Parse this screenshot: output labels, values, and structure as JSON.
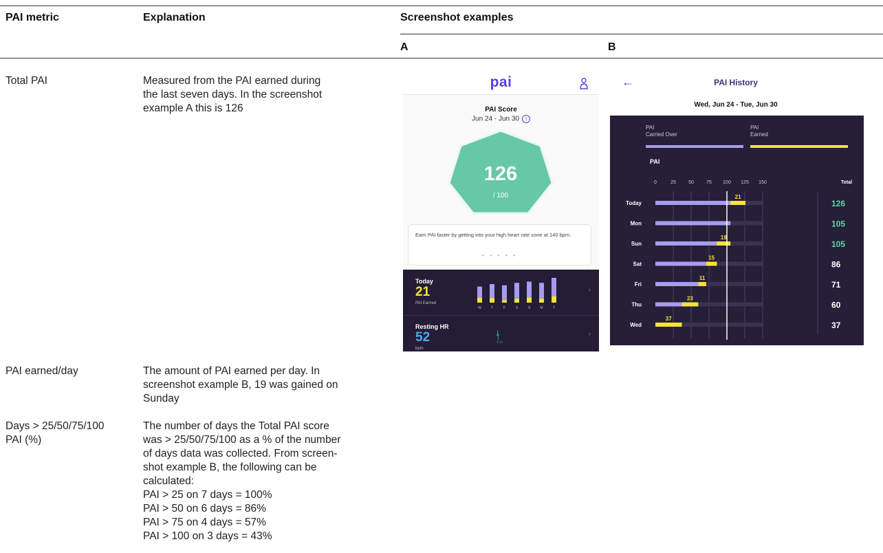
{
  "table": {
    "headers": {
      "metric": "PAI metric",
      "explanation": "Explanation",
      "screenshots": "Screenshot examples",
      "shot_a": "A",
      "shot_b": "B"
    },
    "rows": [
      {
        "metric": "Total PAI",
        "explanation": "Measured from the PAI earned during\nthe last seven days. In the screenshot\nexample A this is 126"
      },
      {
        "metric": "PAI earned/day",
        "explanation": "The amount of PAI earned per day. In\nscreenshot example B, 19 was gained on\nSunday"
      },
      {
        "metric": "Days > 25/50/75/100\nPAI (%)",
        "explanation": "The number of days the Total PAI score\nwas > 25/50/75/100 as a % of the number\nof days data was collected. From screen-\nshot example B, the following can be\ncalculated:\nPAI > 25 on 7 days = 100%\nPAI > 50 on 6 days = 86%\nPAI > 75 on 4 days = 57%\nPAI > 100 on 3 days = 43%"
      }
    ]
  },
  "screenshot_a": {
    "logo": "pai",
    "score_title": "PAI Score",
    "score_range": "Jun 24 - Jun 30",
    "info_glyph": "i",
    "score_value": "126",
    "score_max": "/ 100",
    "tip_text": "Earn PAI faster by getting into your high heart rate zone at 140 bpm.",
    "dots": "● ● ● ● ●",
    "today_label": "Today",
    "today_value": "21",
    "today_sub": "PAI Earned",
    "week_days": [
      "W",
      "T",
      "F",
      "S",
      "S",
      "M",
      "T"
    ],
    "week_bars": [
      {
        "total": 0.65,
        "earned": 0.3
      },
      {
        "total": 0.75,
        "earned": 0.25
      },
      {
        "total": 0.7,
        "earned": 0.15
      },
      {
        "total": 0.8,
        "earned": 0.2
      },
      {
        "total": 0.85,
        "earned": 0.25
      },
      {
        "total": 0.8,
        "earned": 0.2
      },
      {
        "total": 1.0,
        "earned": 0.25
      }
    ],
    "hr_label": "Resting HR",
    "hr_value": "52",
    "hr_unit": "bpm",
    "hr_time": "1:11",
    "chevron": "›",
    "colors": {
      "brand": "#5b3fd6",
      "hex": "#66c8a6",
      "earned": "#f7e23a",
      "carried": "#a99bef",
      "hr": "#4fa8e8",
      "dark": "#231d35"
    }
  },
  "screenshot_b": {
    "back_glyph": "←",
    "title": "PAI History",
    "range": "Wed, Jun 24 - Tue, Jun 30",
    "legend": [
      {
        "line1": "PAI",
        "line2": "Carried Over",
        "color": "#a99bef"
      },
      {
        "line1": "PAI",
        "line2": "Earned",
        "color": "#f7e23a"
      }
    ],
    "chart_label": "PAI",
    "colors": {
      "panel": "#251f37",
      "carried": "#a99bef",
      "earned": "#f7e23a",
      "total_green": "#5cd6a8",
      "total_white": "#ffffff",
      "track": "#3a3350",
      "threshold": "#ffffff"
    }
  },
  "chart_data": {
    "type": "bar",
    "stacked": true,
    "orientation": "horizontal",
    "title": "PAI History",
    "subtitle": "Wed, Jun 24 - Tue, Jun 30",
    "xlabel": "PAI",
    "xlim": [
      0,
      150
    ],
    "x_ticks": [
      0,
      25,
      50,
      75,
      100,
      125,
      150
    ],
    "total_header": "Total",
    "threshold": 100,
    "categories": [
      "Today",
      "Mon",
      "Sun",
      "Sat",
      "Fri",
      "Thu",
      "Wed"
    ],
    "series": [
      {
        "name": "Carried Over",
        "values": [
          105,
          105,
          86,
          71,
          60,
          37,
          0
        ]
      },
      {
        "name": "Earned",
        "values": [
          21,
          0,
          19,
          15,
          11,
          23,
          37
        ]
      }
    ],
    "earned_labels": [
      "21",
      "",
      "19",
      "15",
      "11",
      "23",
      "37"
    ],
    "totals": [
      126,
      105,
      105,
      86,
      71,
      60,
      37
    ],
    "legend": "top"
  }
}
